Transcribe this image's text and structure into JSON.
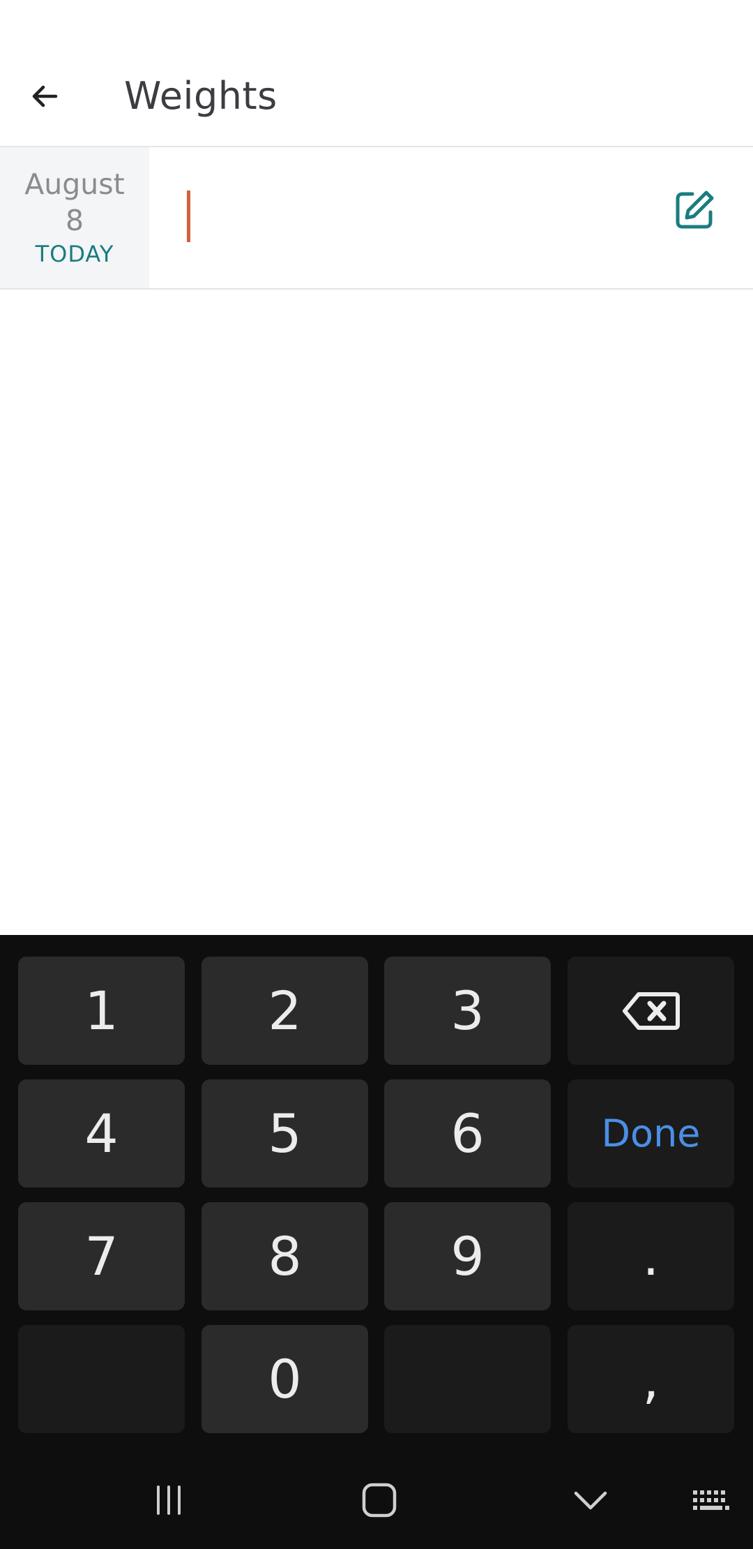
{
  "header": {
    "title": "Weights",
    "back_icon": "arrow-left-icon"
  },
  "entry": {
    "date_month": "August",
    "date_day": "8",
    "date_label": "TODAY",
    "input_value": "",
    "edit_icon": "edit-icon"
  },
  "keyboard": {
    "rows": [
      [
        "1",
        "2",
        "3",
        "backspace"
      ],
      [
        "4",
        "5",
        "6",
        "Done"
      ],
      [
        "7",
        "8",
        "9",
        "."
      ],
      [
        "",
        "0",
        "",
        ","
      ]
    ],
    "done_label": "Done",
    "backspace_icon": "backspace-icon"
  },
  "navbar": {
    "icons": [
      "recent-apps-icon",
      "home-icon",
      "hide-keyboard-icon",
      "keyboard-switch-icon"
    ]
  },
  "colors": {
    "accent_teal": "#1a7c80",
    "caret": "#d4603a",
    "done_blue": "#4a8fe7",
    "keyboard_bg": "#0e0e0e",
    "key_bg": "#2b2b2b"
  }
}
